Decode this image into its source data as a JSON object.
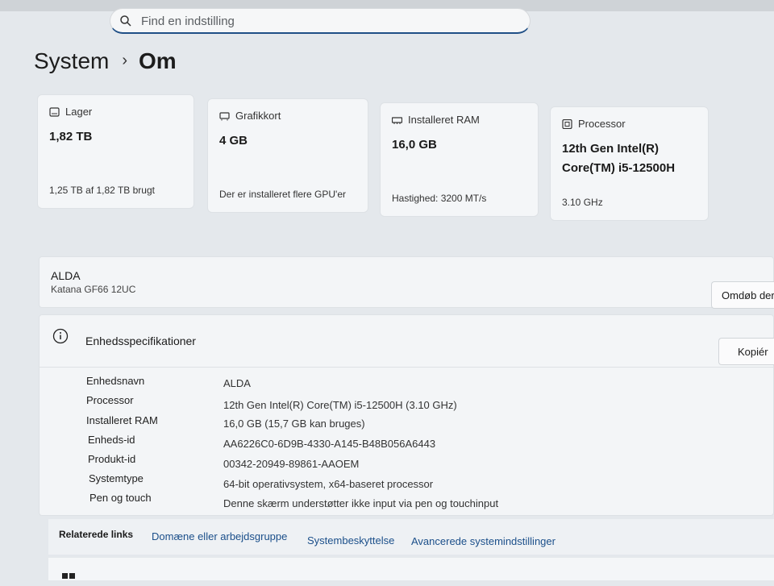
{
  "search": {
    "placeholder": "Find en indstilling"
  },
  "breadcrumb": {
    "parent": "System",
    "separator": "›",
    "current": "Om"
  },
  "cards": [
    {
      "icon": "storage-icon",
      "label": "Lager",
      "value": "1,82 TB",
      "sub": "1,25 TB af 1,82 TB brugt"
    },
    {
      "icon": "graphics-card-icon",
      "label": "Grafikkort",
      "value": "4 GB",
      "sub": "Der er installeret flere GPU'er"
    },
    {
      "icon": "ram-icon",
      "label": "Installeret RAM",
      "value": "16,0 GB",
      "sub": "Hastighed: 3200 MT/s"
    },
    {
      "icon": "processor-icon",
      "label": "Processor",
      "value_line1": "12th Gen Intel(R)",
      "value_line2": "Core(TM) i5-12500H",
      "sub": "3.10 GHz"
    }
  ],
  "device": {
    "name": "ALDA",
    "model": "Katana GF66 12UC",
    "rename_label": "Omdøb der"
  },
  "specs": {
    "title": "Enhedsspecifikationer",
    "copy_label": "Kopiér",
    "rows": [
      {
        "key": "Enhedsnavn",
        "value": "ALDA"
      },
      {
        "key": "Processor",
        "value": "12th Gen Intel(R) Core(TM) i5-12500H (3.10 GHz)"
      },
      {
        "key": "Installeret RAM",
        "value": "16,0 GB (15,7 GB kan bruges)"
      },
      {
        "key": "Enheds-id",
        "value": "AA6226C0-6D9B-4330-A145-B48B056A6443"
      },
      {
        "key": "Produkt-id",
        "value": "00342-20949-89861-AAOEM"
      },
      {
        "key": "Systemtype",
        "value": "64-bit operativsystem, x64-baseret processor"
      },
      {
        "key": "Pen og touch",
        "value": "Denne skærm understøtter ikke input via pen og touchinput"
      }
    ]
  },
  "related": {
    "title": "Relaterede links",
    "links": [
      "Domæne eller arbejdsgruppe",
      "Systembeskyttelse",
      "Avancerede systemindstillinger"
    ]
  },
  "colors": {
    "accent": "#1f4f86",
    "link": "#1b4f8a",
    "background": "#e4e8ec"
  }
}
